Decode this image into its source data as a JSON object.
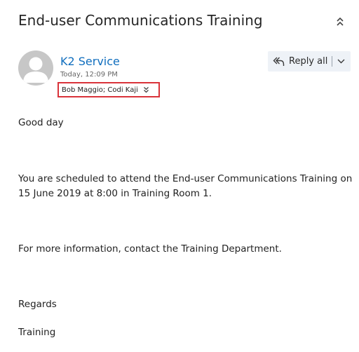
{
  "email": {
    "subject": "End-user Communications Training",
    "sender": "K2 Service",
    "timestamp": "Today, 12:09 PM",
    "recipients": "Bob Maggio; Codi Kaji",
    "body": {
      "greeting": "Good day",
      "schedule_line1": "You are scheduled to attend the End-user Communications Training on",
      "schedule_line2": "15 June 2019 at 8:00 in Training Room 1.",
      "info": "For more information, contact the Training Department.",
      "regards": "Regards",
      "signature": "Training"
    }
  },
  "actions": {
    "reply_all_label": "Reply all"
  },
  "icons": {
    "collapse": "double-chevron-up-icon",
    "avatar": "person-silhouette-icon",
    "recipients_expand": "double-chevron-down-icon",
    "reply_all": "reply-all-icon",
    "dropdown": "chevron-down-icon"
  },
  "colors": {
    "sender_link": "#106ebe",
    "recipients_highlight": "#d9333a",
    "reply_button_bg": "#eef2f7",
    "avatar_bg": "#c7c7c7"
  }
}
